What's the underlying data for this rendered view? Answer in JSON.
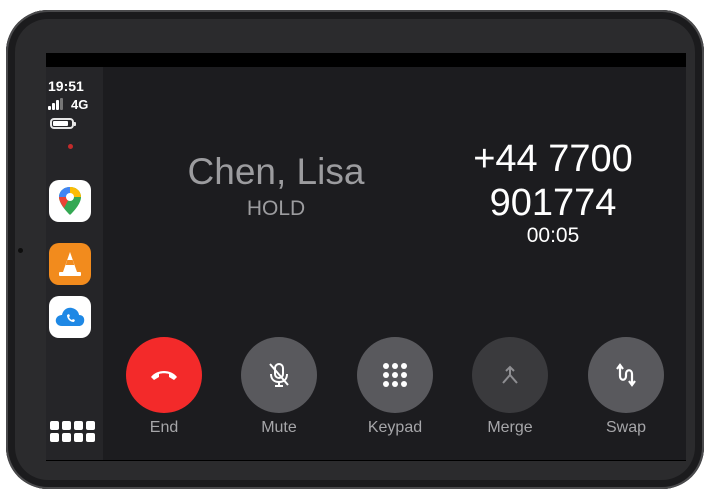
{
  "status_bar": {
    "time": "19:51",
    "network": "4G"
  },
  "dock": {
    "apps": [
      {
        "name": "maps-app",
        "icon": "map-pin-icon",
        "color": "#34a853"
      },
      {
        "name": "vlc-app",
        "icon": "traffic-cone-icon",
        "color": "#f28b1d"
      },
      {
        "name": "cloud-phone-app",
        "icon": "cloud-phone-icon",
        "color": "#1e88e5"
      }
    ],
    "grid_icon": "app-grid-icon"
  },
  "call": {
    "contact_name": "Chen, Lisa",
    "status": "HOLD",
    "number_line1": "+44 7700",
    "number_line2": "901774",
    "duration": "00:05"
  },
  "controls": {
    "end": "End",
    "mute": "Mute",
    "keypad": "Keypad",
    "merge": "Merge",
    "swap": "Swap"
  },
  "colors": {
    "end_button": "#f32a2a",
    "button": "#59595d",
    "disabled_button": "#3a3a3d",
    "background": "#1c1c1f",
    "sidebar": "#252528"
  }
}
